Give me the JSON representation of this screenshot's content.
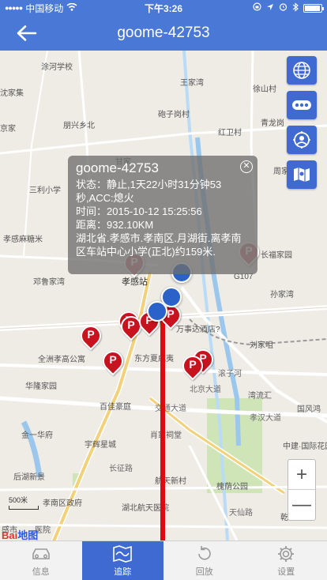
{
  "status_bar": {
    "carrier": "中国移动",
    "time": "下午3:26"
  },
  "nav": {
    "title": "goome-42753"
  },
  "popup": {
    "title": "goome-42753",
    "status": "状态：静止,1天22小时31分钟53秒,ACC:熄火",
    "time": "时间：2015-10-12 15:25:56",
    "distance": "距离：932.10KM",
    "address": "湖北省.孝感市.孝南区.月湖街.离孝南区车站中心小学(正北)约159米."
  },
  "map_controls": {
    "buttons": [
      "globe-icon",
      "traffic-icon",
      "location-icon",
      "map-layer-icon"
    ],
    "zoom_in": "+",
    "zoom_out": "—"
  },
  "map": {
    "scale": "500米",
    "logo_left": "Bai",
    "logo_right": "地图",
    "labels": [
      "涂河学校",
      "徐山村",
      "沈家集",
      "砲子岗村",
      "红卫村",
      "朋兴乡北",
      "青龙岗",
      "京家",
      "三利小学",
      "周家",
      "孝感麻糖米",
      "长福家园",
      "邓鲁家湾",
      "孝感站",
      "孙家湾",
      "刘家咀",
      "万事达酒店?",
      "全洲孝高公寓",
      "东方夏威夷",
      "华隆家园",
      "湾流汇",
      "国风鸿",
      "百佳豪庭",
      "北京大道",
      "孝汉大道",
      "金一华府",
      "肖家祠堂",
      "中建·国际花园",
      "宇辉星城",
      "长征路",
      "后湖新景",
      "航天新村",
      "槐荫公园",
      "孝南区政府",
      "湖北航天医院",
      "天仙路",
      "乾坤豪府",
      "感市",
      "医院",
      "交通大道",
      "滚子河",
      "G107",
      "王家湾",
      "甘家"
    ]
  },
  "tabs": [
    {
      "label": "信息",
      "icon": "car-icon"
    },
    {
      "label": "追踪",
      "icon": "map-icon"
    },
    {
      "label": "回放",
      "icon": "replay-icon"
    },
    {
      "label": "设置",
      "icon": "settings-icon"
    }
  ],
  "colors": {
    "accent": "#3f6ad2",
    "nav": "#4a78d6",
    "route": "#e10a0a",
    "pin": "#c8121e"
  }
}
